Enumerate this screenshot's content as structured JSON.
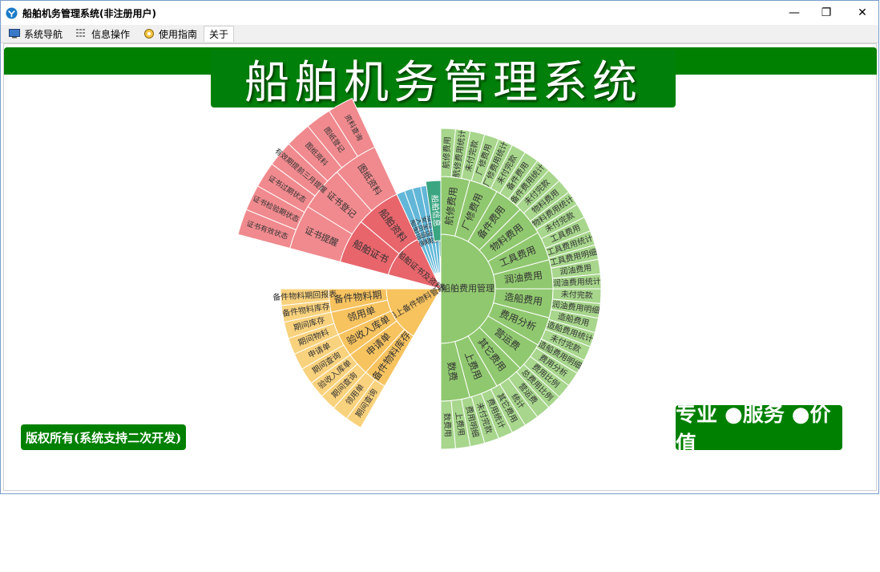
{
  "window": {
    "title": "船舶机务管理系统(非注册用户)",
    "minimize_glyph": "—",
    "maximize_glyph": "❐",
    "close_glyph": "✕"
  },
  "menu": {
    "tabs": [
      {
        "label": "系统导航",
        "icon": "monitor-icon"
      },
      {
        "label": "信息操作",
        "icon": "grid-icon"
      },
      {
        "label": "使用指南",
        "icon": "guide-icon"
      },
      {
        "label": "关于",
        "icon": ""
      }
    ]
  },
  "banner": {
    "title": "船舶机务管理系统"
  },
  "footer": {
    "copyright": "版权所有(系统支持二次开发)",
    "slogan": "专业 ●服务 ●价值"
  },
  "colors": {
    "green": "#008000",
    "fee": "#90c86f",
    "fee_outer": "#a7d68c",
    "cert": "#e8656c",
    "cert_outer": "#f08a8e",
    "parts": "#f7c35f",
    "parts_outer": "#f9d27d",
    "info": "#62b7d8",
    "teal": "#3aa580"
  },
  "sunburst": {
    "center_label": "船舶费用管理",
    "fee_ring": [
      "航修费用",
      "厂修费用",
      "备件费用",
      "物料费用",
      "工具费用",
      "润油费用",
      "造船费用",
      "费用分析",
      "营运费",
      "其它费用",
      "上费用",
      "数费"
    ],
    "fee_outer": [
      "航修费用",
      "航修费用统计",
      "未付完款",
      "厂修费用",
      "厂修费用统计",
      "未付完款",
      "备件费用",
      "备件费用统计",
      "未付完款",
      "物料费用",
      "物料费用统计",
      "未付完款",
      "工具费用",
      "工具费用统计",
      "工具费用明细",
      "润油费用",
      "润油费用统计",
      "未付完款",
      "润油费用明细",
      "造船费用",
      "造船费用统计",
      "未付完款",
      "造船费用明细",
      "费用分析",
      "费用比例",
      "总费用比例",
      "营运费",
      "统计",
      "其它费用",
      "费用统计",
      "未付完款",
      "费用明细",
      "上费用",
      "数费用"
    ],
    "cert_ring": [
      "船舶证书",
      "船舶资料"
    ],
    "cert_middle": [
      "证书提醒",
      "证书登记",
      "图纸资料"
    ],
    "cert_outer": [
      "证书有效状态",
      "证书检验期状态",
      "证书过期状态",
      "有效期提前三月提醒",
      "图纸资料",
      "图纸登记",
      "资料查询"
    ],
    "cert_hub": "船舶证书及资料",
    "parts_ring": [
      "备件物料库存",
      "申请单",
      "验收入库单",
      "领用单",
      "备件物料期",
      "船上备件物料管理"
    ],
    "parts_outer": [
      "期间查询",
      "领用单",
      "期间查询",
      "验收入库单",
      "期间查询",
      "申请单",
      "期间物料",
      "期间库存",
      "备件物料库存",
      "备件物料期回报表"
    ],
    "info_labels": [
      "船舶信息",
      "人员信息",
      "安全信息",
      "维修信息",
      "设备信息"
    ],
    "teal_label": "船舶信息"
  }
}
